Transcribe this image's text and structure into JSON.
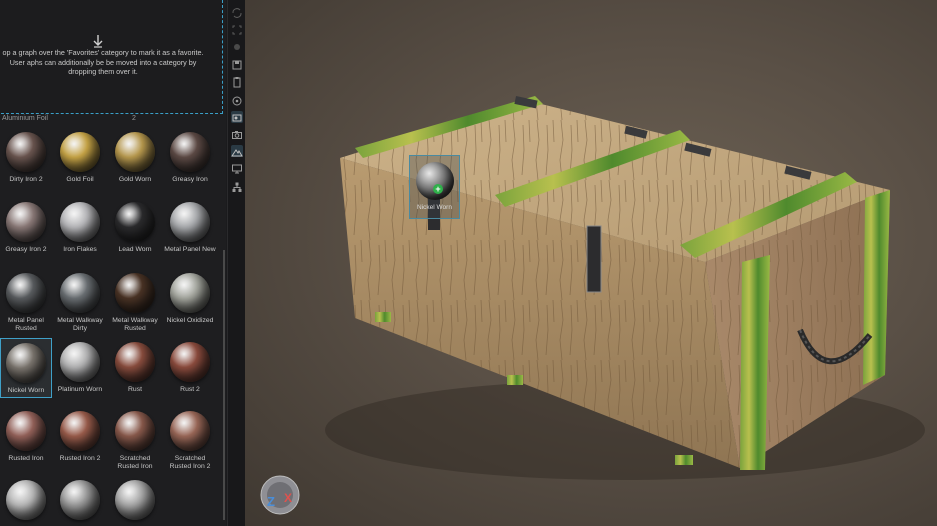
{
  "library": {
    "dropzone_text": "op a graph over the 'Favorites' category to mark it as a favorite. User aphs can additionally be be moved into a category by dropping them over it.",
    "category_left": "Aluminium Foil",
    "category_right": "2",
    "materials": [
      {
        "label": "Dirty Iron 2",
        "color": "#6b5650"
      },
      {
        "label": "Gold Foil",
        "color": "#c8a546"
      },
      {
        "label": "Gold Worn",
        "color": "#b99a4e"
      },
      {
        "label": "Greasy Iron",
        "color": "#5e4b46"
      },
      {
        "label": "Greasy Iron 2",
        "color": "#8b7a78"
      },
      {
        "label": "Iron Flakes",
        "color": "#b7b7ba"
      },
      {
        "label": "Lead Worn",
        "color": "#2b2b2d"
      },
      {
        "label": "Metal Panel New",
        "color": "#a9abae"
      },
      {
        "label": "Metal Panel Rusted",
        "color": "#5a5d60"
      },
      {
        "label": "Metal Walkway Dirty",
        "color": "#6b7074"
      },
      {
        "label": "Metal Walkway Rusted",
        "color": "#4a3325"
      },
      {
        "label": "Nickel Oxidized",
        "color": "#a5a79f"
      },
      {
        "label": "Nickel Worn",
        "color": "#7b756e"
      },
      {
        "label": "Platinum Worn",
        "color": "#b3b3b4"
      },
      {
        "label": "Rust",
        "color": "#8a4d3e"
      },
      {
        "label": "Rust 2",
        "color": "#8d4c3e"
      },
      {
        "label": "Rusted Iron",
        "color": "#95625a"
      },
      {
        "label": "Rusted Iron 2",
        "color": "#9a5c4b"
      },
      {
        "label": "Scratched Rusted Iron",
        "color": "#8a5a4c"
      },
      {
        "label": "Scratched Rusted Iron 2",
        "color": "#9b6858"
      },
      {
        "label": "",
        "color": "#b8b8b8"
      },
      {
        "label": "",
        "color": "#9a9a9a"
      },
      {
        "label": "",
        "color": "#a8a8a8"
      }
    ],
    "selected_index": 12
  },
  "viewport": {
    "drag_preview_label": "Nickel Worn"
  },
  "tools": [
    "sync-icon",
    "fit-icon",
    "dot-icon",
    "save-icon",
    "clipboard-icon",
    "target-icon",
    "material-icon",
    "camera-icon",
    "environment-icon",
    "display-icon",
    "hierarchy-icon"
  ],
  "axis_gizmo": {
    "z": "Z",
    "x": "X"
  }
}
